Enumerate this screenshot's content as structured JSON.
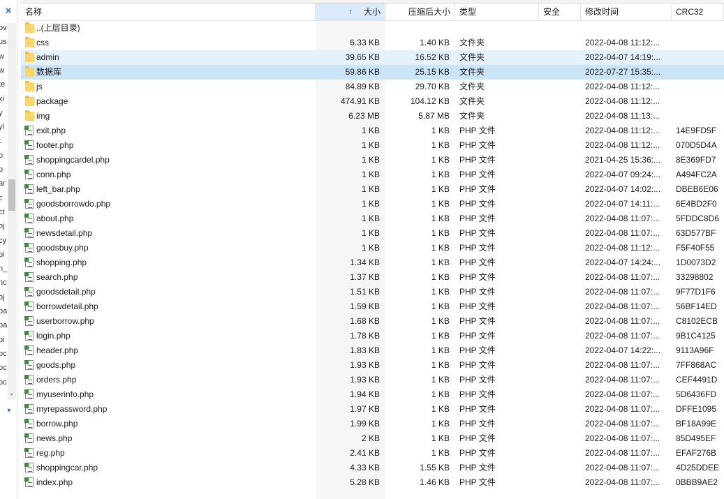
{
  "sidebar": {
    "close_glyph": "×",
    "fragments": [
      "ov",
      "us",
      "w",
      "w",
      "te",
      "xi",
      "y",
      "yl",
      "t",
      "o",
      "p",
      "ar",
      "c",
      "ct",
      "oj",
      "cy",
      "oi",
      "n_",
      "nc",
      "oj",
      "pa",
      "pa",
      "pi",
      "oc",
      "oc",
      "pc"
    ],
    "scroll_down_glyph": "⌄",
    "dropdown_glyph": "▾"
  },
  "columns": {
    "name": "名称",
    "size": "大小",
    "compressed": "压缩后大小",
    "type": "类型",
    "security": "安全",
    "modified": "修改时间",
    "crc": "CRC32",
    "sort_indicator": "🠕"
  },
  "files": [
    {
      "name": "..(上层目录)",
      "size": "",
      "compressed": "",
      "type": "",
      "modified": "",
      "crc": "",
      "kind": "folder"
    },
    {
      "name": "css",
      "size": "6.33 KB",
      "compressed": "1.40 KB",
      "type": "文件夹",
      "modified": "2022-04-08 11:12:...",
      "crc": "",
      "kind": "folder"
    },
    {
      "name": "admin",
      "size": "39.65 KB",
      "compressed": "16.52 KB",
      "type": "文件夹",
      "modified": "2022-04-07 14:19:...",
      "crc": "",
      "kind": "folder"
    },
    {
      "name": "数据库",
      "size": "59.86 KB",
      "compressed": "25.15 KB",
      "type": "文件夹",
      "modified": "2022-07-27 15:35:...",
      "crc": "",
      "kind": "folder"
    },
    {
      "name": "js",
      "size": "84.89 KB",
      "compressed": "29.70 KB",
      "type": "文件夹",
      "modified": "2022-04-08 11:12:...",
      "crc": "",
      "kind": "folder"
    },
    {
      "name": "package",
      "size": "474.91 KB",
      "compressed": "104.12 KB",
      "type": "文件夹",
      "modified": "2022-04-08 11:12:...",
      "crc": "",
      "kind": "folder"
    },
    {
      "name": "img",
      "size": "6.23 MB",
      "compressed": "5.87 MB",
      "type": "文件夹",
      "modified": "2022-04-08 11:13:...",
      "crc": "",
      "kind": "folder"
    },
    {
      "name": "exit.php",
      "size": "1 KB",
      "compressed": "1 KB",
      "type": "PHP 文件",
      "modified": "2022-04-08 11:12:...",
      "crc": "14E9FD5F",
      "kind": "php"
    },
    {
      "name": "footer.php",
      "size": "1 KB",
      "compressed": "1 KB",
      "type": "PHP 文件",
      "modified": "2022-04-08 11:12:...",
      "crc": "070D5D4A",
      "kind": "php"
    },
    {
      "name": "shoppingcardel.php",
      "size": "1 KB",
      "compressed": "1 KB",
      "type": "PHP 文件",
      "modified": "2021-04-25 15:36:...",
      "crc": "8E369FD7",
      "kind": "php"
    },
    {
      "name": "conn.php",
      "size": "1 KB",
      "compressed": "1 KB",
      "type": "PHP 文件",
      "modified": "2022-04-07 09:24:...",
      "crc": "A494FC2A",
      "kind": "php"
    },
    {
      "name": "left_bar.php",
      "size": "1 KB",
      "compressed": "1 KB",
      "type": "PHP 文件",
      "modified": "2022-04-07 14:02:...",
      "crc": "DBEB6E06",
      "kind": "php"
    },
    {
      "name": "goodsborrowdo.php",
      "size": "1 KB",
      "compressed": "1 KB",
      "type": "PHP 文件",
      "modified": "2022-04-07 14:11:...",
      "crc": "6E4BD2F0",
      "kind": "php"
    },
    {
      "name": "about.php",
      "size": "1 KB",
      "compressed": "1 KB",
      "type": "PHP 文件",
      "modified": "2022-04-08 11:07:...",
      "crc": "5FDDC8D6",
      "kind": "php"
    },
    {
      "name": "newsdetail.php",
      "size": "1 KB",
      "compressed": "1 KB",
      "type": "PHP 文件",
      "modified": "2022-04-08 11:07:...",
      "crc": "63D577BF",
      "kind": "php"
    },
    {
      "name": "goodsbuy.php",
      "size": "1 KB",
      "compressed": "1 KB",
      "type": "PHP 文件",
      "modified": "2022-04-08 11:12:...",
      "crc": "F5F40F55",
      "kind": "php"
    },
    {
      "name": "shopping.php",
      "size": "1.34 KB",
      "compressed": "1 KB",
      "type": "PHP 文件",
      "modified": "2022-04-07 14:24:...",
      "crc": "1D0073D2",
      "kind": "php"
    },
    {
      "name": "search.php",
      "size": "1.37 KB",
      "compressed": "1 KB",
      "type": "PHP 文件",
      "modified": "2022-04-08 11:07:...",
      "crc": "33298802",
      "kind": "php"
    },
    {
      "name": "goodsdetail.php",
      "size": "1.51 KB",
      "compressed": "1 KB",
      "type": "PHP 文件",
      "modified": "2022-04-08 11:07:...",
      "crc": "9F77D1F6",
      "kind": "php"
    },
    {
      "name": "borrowdetail.php",
      "size": "1.59 KB",
      "compressed": "1 KB",
      "type": "PHP 文件",
      "modified": "2022-04-08 11:07:...",
      "crc": "56BF14ED",
      "kind": "php"
    },
    {
      "name": "userborrow.php",
      "size": "1.68 KB",
      "compressed": "1 KB",
      "type": "PHP 文件",
      "modified": "2022-04-08 11:07:...",
      "crc": "C8102ECB",
      "kind": "php"
    },
    {
      "name": "login.php",
      "size": "1.78 KB",
      "compressed": "1 KB",
      "type": "PHP 文件",
      "modified": "2022-04-08 11:07:...",
      "crc": "9B1C4125",
      "kind": "php"
    },
    {
      "name": "header.php",
      "size": "1.83 KB",
      "compressed": "1 KB",
      "type": "PHP 文件",
      "modified": "2022-04-07 14:22:...",
      "crc": "9113A96F",
      "kind": "php"
    },
    {
      "name": "goods.php",
      "size": "1.93 KB",
      "compressed": "1 KB",
      "type": "PHP 文件",
      "modified": "2022-04-08 11:07:...",
      "crc": "7FF868AC",
      "kind": "php"
    },
    {
      "name": "orders.php",
      "size": "1.93 KB",
      "compressed": "1 KB",
      "type": "PHP 文件",
      "modified": "2022-04-08 11:07:...",
      "crc": "CEF4491D",
      "kind": "php"
    },
    {
      "name": "myuserinfo.php",
      "size": "1.94 KB",
      "compressed": "1 KB",
      "type": "PHP 文件",
      "modified": "2022-04-08 11:07:...",
      "crc": "5D6436FD",
      "kind": "php"
    },
    {
      "name": "myrepassword.php",
      "size": "1.97 KB",
      "compressed": "1 KB",
      "type": "PHP 文件",
      "modified": "2022-04-08 11:07:...",
      "crc": "DFFE1095",
      "kind": "php"
    },
    {
      "name": "borrow.php",
      "size": "1.99 KB",
      "compressed": "1 KB",
      "type": "PHP 文件",
      "modified": "2022-04-08 11:07:...",
      "crc": "BF18A99E",
      "kind": "php"
    },
    {
      "name": "news.php",
      "size": "2 KB",
      "compressed": "1 KB",
      "type": "PHP 文件",
      "modified": "2022-04-08 11:07:...",
      "crc": "85D495EF",
      "kind": "php"
    },
    {
      "name": "reg.php",
      "size": "2.41 KB",
      "compressed": "1 KB",
      "type": "PHP 文件",
      "modified": "2022-04-08 11:07:...",
      "crc": "EFAF276B",
      "kind": "php"
    },
    {
      "name": "shoppingcar.php",
      "size": "4.33 KB",
      "compressed": "1.55 KB",
      "type": "PHP 文件",
      "modified": "2022-04-08 11:07:...",
      "crc": "4D25DDEE",
      "kind": "php"
    },
    {
      "name": "index.php",
      "size": "5.28 KB",
      "compressed": "1.46 KB",
      "type": "PHP 文件",
      "modified": "2022-04-08 11:07:...",
      "crc": "0BBB9AE2",
      "kind": "php"
    }
  ],
  "colors": {
    "selected_row": "#cce4f7",
    "hover_row": "#e5f1fb",
    "sorted_header": "#dcebfb",
    "folder": "#f8d66d",
    "php_badge": "#3b8c3b"
  }
}
